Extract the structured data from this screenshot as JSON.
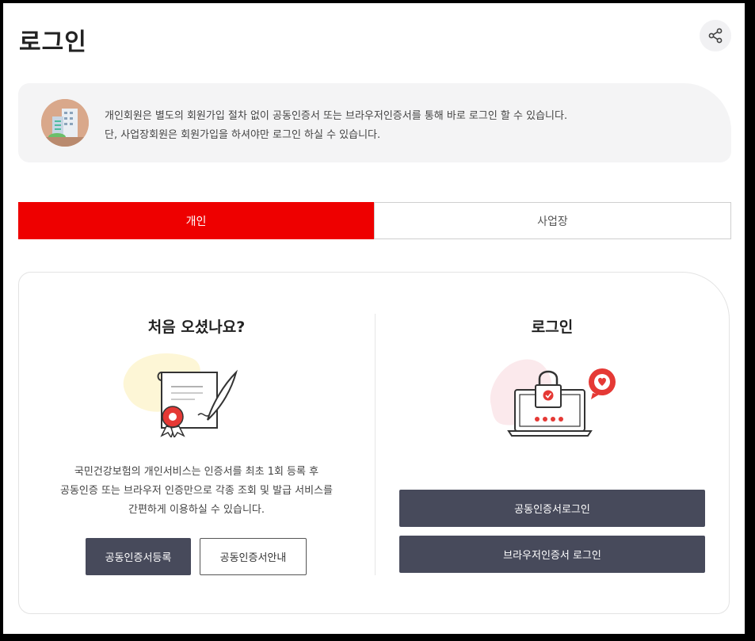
{
  "header": {
    "title": "로그인",
    "share_icon": "share-icon"
  },
  "info": {
    "icon": "building-icon",
    "line1": "개인회원은 별도의 회원가입 절차 없이 공동인증서 또는 브라우저인증서를 통해 바로 로그인 할 수 있습니다.",
    "line2": "단, 사업장회원은 회원가입을 하셔야만 로그인 하실 수 있습니다."
  },
  "tabs": [
    {
      "label": "개인",
      "active": true
    },
    {
      "label": "사업장",
      "active": false
    }
  ],
  "left": {
    "title": "처음 오셨나요?",
    "illustration": "certificate-icon",
    "desc1": "국민건강보험의 개인서비스는 인증서를 최초 1회 등록 후",
    "desc2": "공동인증 또는 브라우저 인증만으로 각종 조회 및 발급 서비스를",
    "desc3": "간편하게 이용하실 수 있습니다.",
    "register_button": "공동인증서등록",
    "guide_button": "공동인증서안내"
  },
  "right": {
    "title": "로그인",
    "illustration": "laptop-lock-icon",
    "cert_login_button": "공동인증서로그인",
    "browser_login_button": "브라우저인증서 로그인"
  },
  "colors": {
    "accent": "#ee0000",
    "button_dark": "#474a5b",
    "panel_bg": "#f4f4f5"
  }
}
